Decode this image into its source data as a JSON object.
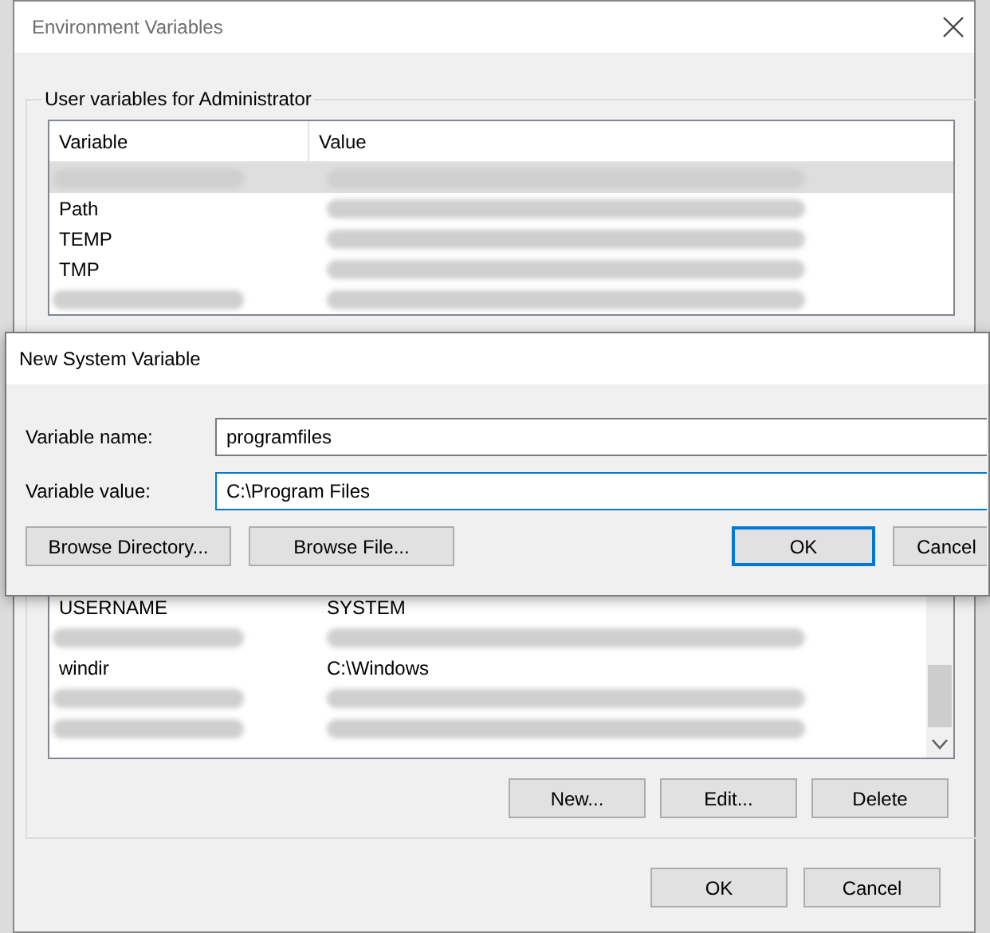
{
  "window": {
    "title": "Environment Variables"
  },
  "user_variables": {
    "title": "User variables for Administrator",
    "columns": [
      "Variable",
      "Value"
    ],
    "rows": [
      {
        "selected": true,
        "variable": {
          "kind": "blurred"
        },
        "value": {
          "kind": "blurred"
        }
      },
      {
        "selected": false,
        "variable": {
          "kind": "text",
          "text": "Path"
        },
        "value": {
          "kind": "blurred"
        }
      },
      {
        "selected": false,
        "variable": {
          "kind": "text",
          "text": "TEMP"
        },
        "value": {
          "kind": "blurred"
        }
      },
      {
        "selected": false,
        "variable": {
          "kind": "text",
          "text": "TMP"
        },
        "value": {
          "kind": "blurred"
        }
      },
      {
        "selected": false,
        "variable": {
          "kind": "blurred"
        },
        "value": {
          "kind": "blurred"
        }
      }
    ]
  },
  "system_variables": {
    "rows": [
      {
        "selected": false,
        "variable": {
          "kind": "text",
          "text": "USERNAME"
        },
        "value": {
          "kind": "text",
          "text": "SYSTEM"
        }
      },
      {
        "selected": false,
        "variable": {
          "kind": "blurred"
        },
        "value": {
          "kind": "blurred"
        }
      },
      {
        "selected": false,
        "variable": {
          "kind": "text",
          "text": "windir"
        },
        "value": {
          "kind": "text",
          "text": "C:\\Windows"
        }
      },
      {
        "selected": false,
        "variable": {
          "kind": "blurred"
        },
        "value": {
          "kind": "blurred"
        }
      },
      {
        "selected": false,
        "variable": {
          "kind": "blurred"
        },
        "value": {
          "kind": "blurred"
        }
      }
    ],
    "buttons": [
      "New...",
      "Edit...",
      "Delete"
    ]
  },
  "buttons": [
    "OK",
    "Cancel"
  ],
  "dialog": {
    "title": "New System Variable",
    "fields": [
      {
        "label": "Variable name:",
        "value": "programfiles",
        "focused": false
      },
      {
        "label": "Variable value:",
        "value": "C:\\Program Files",
        "focused": true
      }
    ],
    "buttons": [
      {
        "label": "Browse Directory...",
        "default": false
      },
      {
        "label": "Browse File...",
        "default": false
      },
      {
        "label": "OK",
        "default": true
      },
      {
        "label": "Cancel",
        "default": false
      }
    ]
  }
}
